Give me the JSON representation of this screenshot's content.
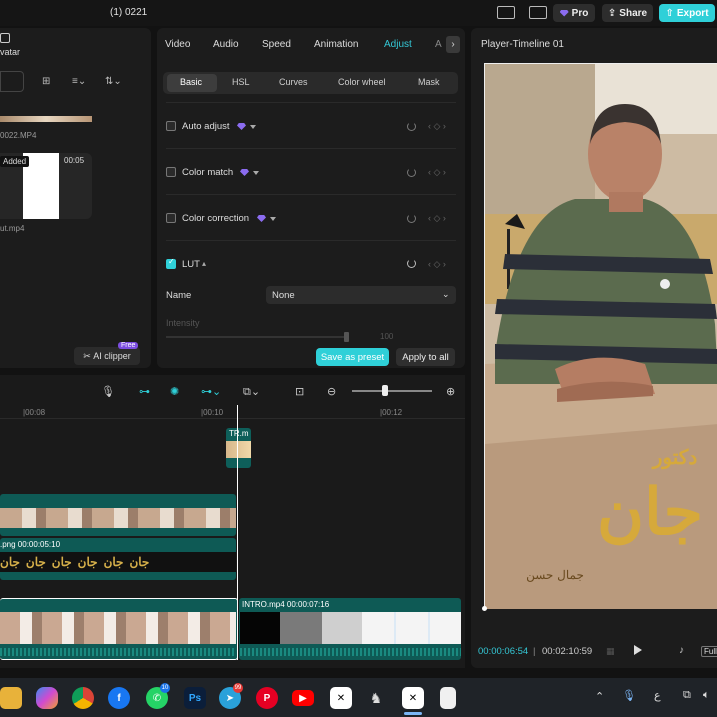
{
  "topbar": {
    "project_title": "(1) 0221",
    "pro_label": "Pro",
    "share_label": "Share",
    "export_label": "Export"
  },
  "media": {
    "tab_label": "vatar",
    "item1_name": "0022.MP4",
    "item2_badge": "Added",
    "item2_duration": "00:05",
    "item2_name": "ut.mp4",
    "ai_clipper_label": "AI clipper",
    "free_badge": "Free"
  },
  "inspector": {
    "tabs": [
      "Video",
      "Audio",
      "Speed",
      "Animation",
      "Adjust",
      "A"
    ],
    "active_tab": "Adjust",
    "subtabs": [
      "Basic",
      "HSL",
      "Curves",
      "Color wheel",
      "Mask"
    ],
    "active_subtab": "Basic",
    "properties": [
      {
        "label": "Auto adjust",
        "checked": false
      },
      {
        "label": "Color match",
        "checked": false
      },
      {
        "label": "Color correction",
        "checked": false
      },
      {
        "label": "LUT",
        "checked": true
      }
    ],
    "name_label": "Name",
    "lut_value": "None",
    "intensity_label": "Intensity",
    "intensity_value": "100",
    "save_preset_label": "Save as preset",
    "apply_all_label": "Apply to all"
  },
  "player": {
    "title": "Player-Timeline 01",
    "current_time": "00:00:06:54",
    "total_time": "00:02:10:59",
    "full_label": "Full",
    "overlay_text_main": "جان",
    "overlay_text_top": "دكتور",
    "overlay_text_sub": "جمال حسن"
  },
  "timeline": {
    "ruler": [
      "|00:08",
      "|00:10",
      "|00:12"
    ],
    "clip_tr_label": "TR.m",
    "clip_png_label": ".png  00:00:05:10",
    "clip_text_word": "جان",
    "clip_intro_label": "INTRO.mp4  00:00:07:16"
  },
  "taskbar": {
    "apps": [
      "file-explorer",
      "copilot",
      "chrome",
      "facebook",
      "whatsapp",
      "photoshop",
      "telegram",
      "pinterest",
      "youtube",
      "capcut",
      "chess",
      "capcut-active",
      "document"
    ],
    "whatsapp_badge": "10",
    "telegram_badge": "99",
    "lang": "ع"
  },
  "colors": {
    "accent": "#2fd0d8",
    "panel": "#1c1c1c",
    "background": "#121212",
    "premium": "#8b6cf0"
  }
}
